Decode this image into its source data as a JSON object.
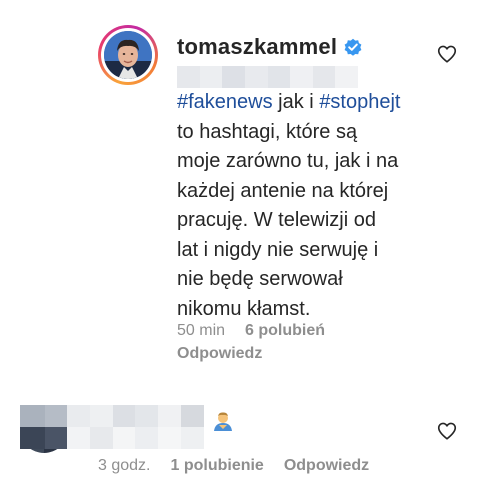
{
  "comment1": {
    "username": "tomaszkammel",
    "verified": true,
    "text_lines": [
      {
        "parts": [
          {
            "t": "#fakenews",
            "tag": true
          },
          {
            "t": " jak i ",
            "tag": false
          },
          {
            "t": "#stophejt",
            "tag": true
          }
        ]
      },
      {
        "parts": [
          {
            "t": "to hashtagi, które są",
            "tag": false
          }
        ]
      },
      {
        "parts": [
          {
            "t": "moje zarówno tu, jak i na",
            "tag": false
          }
        ]
      },
      {
        "parts": [
          {
            "t": "każdej antenie na której",
            "tag": false
          }
        ]
      },
      {
        "parts": [
          {
            "t": "pracuję. W telewizji od",
            "tag": false
          }
        ]
      },
      {
        "parts": [
          {
            "t": "lat i nigdy nie serwuję i",
            "tag": false
          }
        ]
      },
      {
        "parts": [
          {
            "t": "nie będę serwował",
            "tag": false
          }
        ]
      },
      {
        "parts": [
          {
            "t": "nikomu kłamst.",
            "tag": false
          }
        ]
      }
    ],
    "time": "50 min",
    "likes": "6 polubień",
    "reply": "Odpowiedz"
  },
  "comment2": {
    "time": "3 godz.",
    "likes": "1 polubienie",
    "reply": "Odpowiedz"
  },
  "icons": {
    "heart": "heart-outline-icon",
    "verified": "verified-badge-icon",
    "emoji": "person-emoji-icon"
  },
  "colors": {
    "hashtag": "#1f4e9a",
    "muted": "#8e8e8e",
    "verified": "#3897f0",
    "text": "#262626"
  }
}
